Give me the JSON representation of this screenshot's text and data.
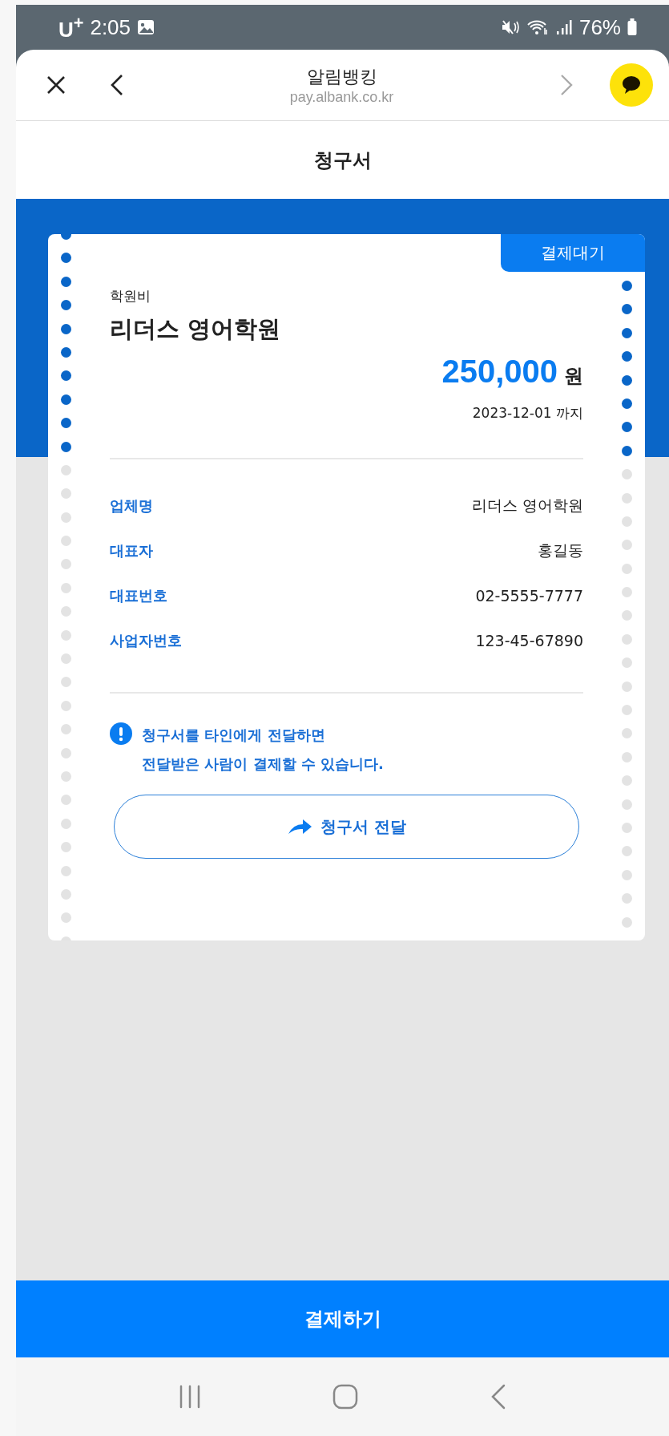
{
  "status_bar": {
    "carrier": "U$^{+}$",
    "time": "2:05",
    "battery": "76%"
  },
  "browser_bar": {
    "title": "알림뱅킹",
    "url": "pay.albank.co.kr",
    "forward_disabled": true
  },
  "page_title": "청구서",
  "invoice": {
    "status": "결제대기",
    "category": "학원비",
    "merchant": "리더스 영어학원",
    "amount": "250,000",
    "currency": "원",
    "due": "2023-12-01 까지",
    "details": [
      {
        "label": "업체명",
        "value": "리더스 영어학원"
      },
      {
        "label": "대표자",
        "value": "홍길동"
      },
      {
        "label": "대표번호",
        "value": "02-5555-7777"
      },
      {
        "label": "사업자번호",
        "value": "123-45-67890"
      }
    ],
    "notice": [
      "청구서를 타인에게 전달하면",
      "전달받은 사람이 결제할 수 있습니다."
    ],
    "forward_button": "청구서 전달"
  },
  "pay_button": "결제하기"
}
